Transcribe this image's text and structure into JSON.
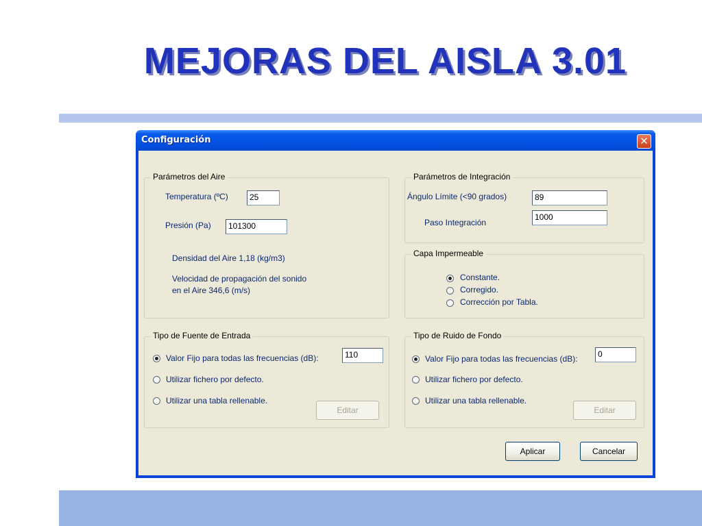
{
  "slide": {
    "title": "MEJORAS DEL AISLA 3.01"
  },
  "dialog": {
    "title": "Configuración",
    "close": "✕",
    "air": {
      "legend": "Parámetros del Aire",
      "temperature_label": "Temperatura (ºC)",
      "temperature_value": "25",
      "pressure_label": "Presión (Pa)",
      "pressure_value": "101300",
      "density_text": "Densidad del Aire 1,18 (kg/m3)",
      "speed_line1": "Velocidad de propagación del sonido",
      "speed_line2": "en el Aire 346,6 (m/s)"
    },
    "integration": {
      "legend": "Parámetros de Integración",
      "angle_label": "Ángulo Límite (<90 grados)",
      "angle_value": "89",
      "step_label": "Paso Integración",
      "step_value": "1000"
    },
    "layer": {
      "legend": "Capa Impermeable",
      "options": [
        "Constante.",
        "Corregido.",
        "Corrección por Tabla."
      ],
      "selected": 0
    },
    "source": {
      "legend": "Tipo de Fuente de Entrada",
      "options": [
        "Valor Fijo para todas las frecuencias (dB):",
        "Utilizar fichero por defecto.",
        "Utilizar una tabla rellenable."
      ],
      "selected": 0,
      "value": "110",
      "edit_label": "Editar"
    },
    "noise": {
      "legend": "Tipo de Ruido de Fondo",
      "options": [
        "Valor Fijo para todas las frecuencias (dB):",
        "Utilizar fichero por defecto.",
        "Utilizar una tabla rellenable."
      ],
      "selected": 0,
      "value": "0",
      "edit_label": "Editar"
    },
    "apply_label": "Aplicar",
    "cancel_label": "Cancelar"
  }
}
